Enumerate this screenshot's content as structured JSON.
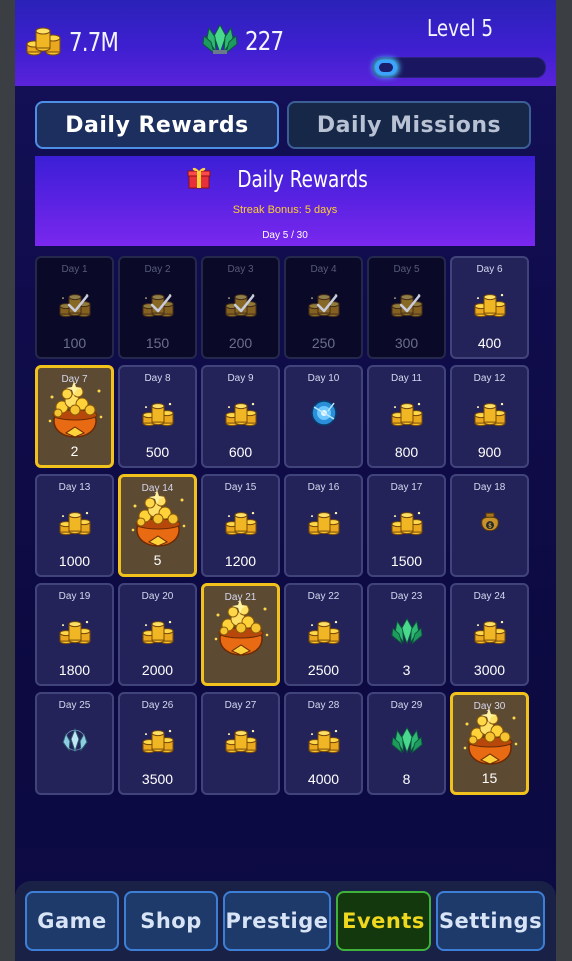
{
  "header": {
    "coins": "7.7M",
    "gems": "227",
    "level_label": "Level 5",
    "level_progress": 0.13
  },
  "tabs": {
    "daily_rewards": "Daily Rewards",
    "daily_missions": "Daily Missions"
  },
  "banner": {
    "title": "Daily Rewards",
    "streak": "Streak Bonus: 5 days",
    "day_counter": "Day 5 / 30"
  },
  "rewards": [
    {
      "day": "Day 1",
      "amount": "100",
      "icon": "coin-pile-icon",
      "state": "claimed"
    },
    {
      "day": "Day 2",
      "amount": "150",
      "icon": "coin-pile-icon",
      "state": "claimed"
    },
    {
      "day": "Day 3",
      "amount": "200",
      "icon": "coin-pile-icon",
      "state": "claimed"
    },
    {
      "day": "Day 4",
      "amount": "250",
      "icon": "coin-pile-icon",
      "state": "claimed"
    },
    {
      "day": "Day 5",
      "amount": "300",
      "icon": "coin-pile-icon",
      "state": "claimed"
    },
    {
      "day": "Day 6",
      "amount": "400",
      "icon": "coin-pile-icon",
      "state": "upcoming"
    },
    {
      "day": "Day 7",
      "amount": "2",
      "icon": "treasure-bag-icon",
      "state": "special"
    },
    {
      "day": "Day 8",
      "amount": "500",
      "icon": "coin-pile-icon",
      "state": "upcoming"
    },
    {
      "day": "Day 9",
      "amount": "600",
      "icon": "coin-pile-icon",
      "state": "upcoming"
    },
    {
      "day": "Day 10",
      "amount": "",
      "icon": "blue-orb-icon",
      "state": "upcoming"
    },
    {
      "day": "Day 11",
      "amount": "800",
      "icon": "coin-pile-icon",
      "state": "upcoming"
    },
    {
      "day": "Day 12",
      "amount": "900",
      "icon": "coin-pile-icon",
      "state": "upcoming"
    },
    {
      "day": "Day 13",
      "amount": "1000",
      "icon": "coin-pile-icon",
      "state": "upcoming"
    },
    {
      "day": "Day 14",
      "amount": "5",
      "icon": "treasure-bag-icon",
      "state": "special"
    },
    {
      "day": "Day 15",
      "amount": "1200",
      "icon": "coin-pile-icon",
      "state": "upcoming"
    },
    {
      "day": "Day 16",
      "amount": "",
      "icon": "coin-pile-icon",
      "state": "upcoming"
    },
    {
      "day": "Day 17",
      "amount": "1500",
      "icon": "coin-pile-icon",
      "state": "upcoming"
    },
    {
      "day": "Day 18",
      "amount": "",
      "icon": "coin-sack-icon",
      "state": "upcoming"
    },
    {
      "day": "Day 19",
      "amount": "1800",
      "icon": "coin-pile-icon",
      "state": "upcoming"
    },
    {
      "day": "Day 20",
      "amount": "2000",
      "icon": "coin-pile-icon",
      "state": "upcoming"
    },
    {
      "day": "Day 21",
      "amount": "",
      "icon": "treasure-bag-icon",
      "state": "special"
    },
    {
      "day": "Day 22",
      "amount": "2500",
      "icon": "coin-pile-icon",
      "state": "upcoming"
    },
    {
      "day": "Day 23",
      "amount": "3",
      "icon": "green-gem-icon",
      "state": "upcoming"
    },
    {
      "day": "Day 24",
      "amount": "3000",
      "icon": "coin-pile-icon",
      "state": "upcoming"
    },
    {
      "day": "Day 25",
      "amount": "",
      "icon": "crystal-cluster-icon",
      "state": "upcoming"
    },
    {
      "day": "Day 26",
      "amount": "3500",
      "icon": "coin-pile-icon",
      "state": "upcoming"
    },
    {
      "day": "Day 27",
      "amount": "",
      "icon": "coin-pile-icon",
      "state": "upcoming"
    },
    {
      "day": "Day 28",
      "amount": "4000",
      "icon": "coin-pile-icon",
      "state": "upcoming"
    },
    {
      "day": "Day 29",
      "amount": "8",
      "icon": "green-gem-icon",
      "state": "upcoming"
    },
    {
      "day": "Day 30",
      "amount": "15",
      "icon": "treasure-bag-icon",
      "state": "special"
    }
  ],
  "nav": [
    "Game",
    "Shop",
    "Prestige",
    "Events",
    "Settings"
  ],
  "nav_active": "Events",
  "colors": {
    "accent_gold": "#f2c21c",
    "tab_border": "#4d8fe6",
    "active_nav_text": "#f0d81e",
    "banner_purple": "#5a22e2"
  }
}
